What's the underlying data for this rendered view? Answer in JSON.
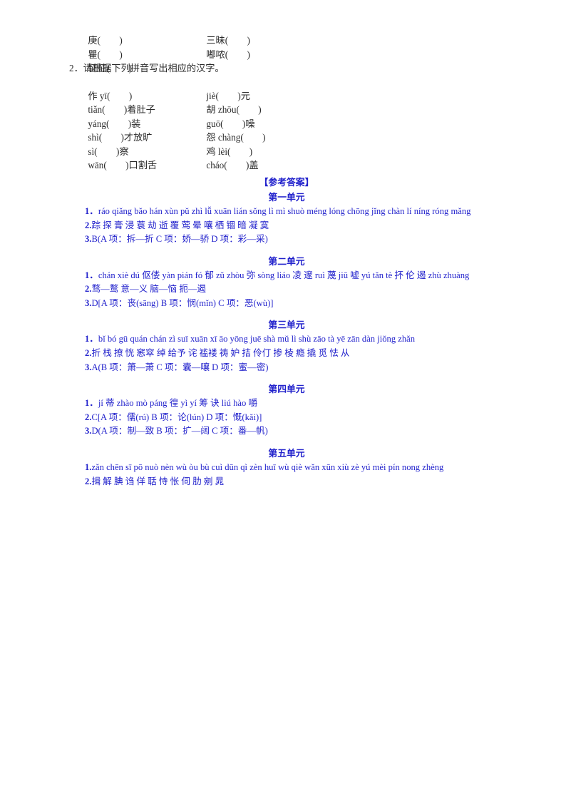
{
  "exercise": {
    "rows": [
      {
        "left": "庚(        )",
        "right": "三昧(        )"
      },
      {
        "left": "瞿(        )",
        "right": "嘟哝(        )"
      },
      {
        "left": "怔怔(        )",
        "right": ""
      }
    ],
    "question2_label": "2．请根据下列拼音写出相应的汉字。",
    "pinyin_rows": [
      {
        "left": "作 yī(        )",
        "right": "jiè(        )元"
      },
      {
        "left": "tiǎn(        )着肚子",
        "right": "胡 zhōu(        )"
      },
      {
        "left": "yáng(        )装",
        "right": "guō(        )噪"
      },
      {
        "left": "shì(        )才放旷",
        "right": "怨 chàng(        )"
      },
      {
        "left": "sì(        )察",
        "right": "鸡 lèi(        )"
      },
      {
        "left": "wān(        )口割舌",
        "right": "cháo(        )盖"
      }
    ]
  },
  "answers": {
    "header": "【参考答案】",
    "units": [
      {
        "title": "第一单元",
        "lines": [
          {
            "num": "1．",
            "text": "ráo   qiǎng bǎo   hán   xùn   pǔ   zhì   lǚ   xuān   lián   sǒng   lì   mì   shuò   méng lóng   chōng jǐng   chàn   lí   níng   róng   mǎng"
          },
          {
            "num": "2.",
            "text": "踪  探  膏  浸  蓑  劫  逝  覆  莺  晕  嚷  栖  锢  暗  凝  寞"
          },
          {
            "num": "3.",
            "text": "B(A 项：拆—折   C 项：娇—骄   D 项：彩—采)"
          }
        ]
      },
      {
        "title": "第二单元",
        "lines": [
          {
            "num": "1．",
            "text": "chán   xiè dú   伛偻   yàn   pián   fó   郁   zǔ zhòu   弥   sòng   liáo   凌   邃   ruì   蔑   jiū   嘘   yú   tǎn tè   抔   伦   遏   zhù   zhuàng"
          },
          {
            "num": "2.",
            "text": "骛—鹜  意—义  脑—恼  扼—遏"
          },
          {
            "num": "3.",
            "text": "D[A 项：丧(sāng)   B 项：悯(mǐn)   C 项：恶(wù)]"
          }
        ]
      },
      {
        "title": "第三单元",
        "lines": [
          {
            "num": "1．",
            "text": "bǐ   bó gū   quán   chán   zì suī   xuān   xī   āo   yōng   juē   shà   mǔ lì   shù   zāo tà   yē   zān   dàn   jiǒng   zhǎn"
          },
          {
            "num": "2.",
            "text": "折  栈  撩  恍  窸窣  绰  给予  诧  褴褛  祷  妒  拮  伶仃  掺  棱  瘾  撬  觅  怯  从"
          },
          {
            "num": "3.",
            "text": "A(B 项：箫—萧   C 项：囊—嚷   D 项：蜜—密)"
          }
        ]
      },
      {
        "title": "第四单元",
        "lines": [
          {
            "num": "1．",
            "text": "jí   蒂   zhào   mò   páng   徨   yì   yí   筹   诀   liú   hào   嚼"
          },
          {
            "num": "2.",
            "text": "C[A 项：儒(rú)   B 项：论(lún)   D 项：慨(kǎi)]"
          },
          {
            "num": "3.",
            "text": "D(A 项：制—致   B 项：扩—阔   C 项：番—帆)"
          }
        ]
      },
      {
        "title": "第五单元",
        "lines": [
          {
            "num": "1.",
            "text": "zǎn   chēn   sī   pō   nuò   nèn   wù   òu   bù   cuì   dūn   qì   zèn   huī   wù   qiè   wǎn   xūn   xiù   zè   yú   mèi   pín   nong   zhèng"
          },
          {
            "num": "2.",
            "text": "揖  解  腆  诌  佯  聒  恃  怅  伺  肋  剜  晁"
          }
        ]
      }
    ]
  },
  "colors": {
    "answer_blue": "#2222cc",
    "exercise_black": "#2a2a2a"
  }
}
